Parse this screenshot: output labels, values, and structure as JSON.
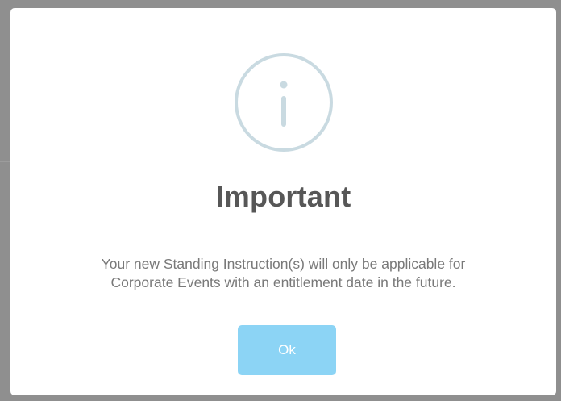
{
  "dialog": {
    "icon": "info-icon",
    "title": "Important",
    "message_lines": [
      "Your new Standing Instruction(s) will only be applicable for",
      "Corporate Events with an entitlement date in the future."
    ],
    "ok_label": "Ok"
  },
  "colors": {
    "overlay": "#8f8f8f",
    "dialog_background": "#ffffff",
    "icon": "#c9dae1",
    "title": "#575757",
    "message": "#797979",
    "button_background": "#8cd4f5",
    "button_text": "#ffffff"
  }
}
